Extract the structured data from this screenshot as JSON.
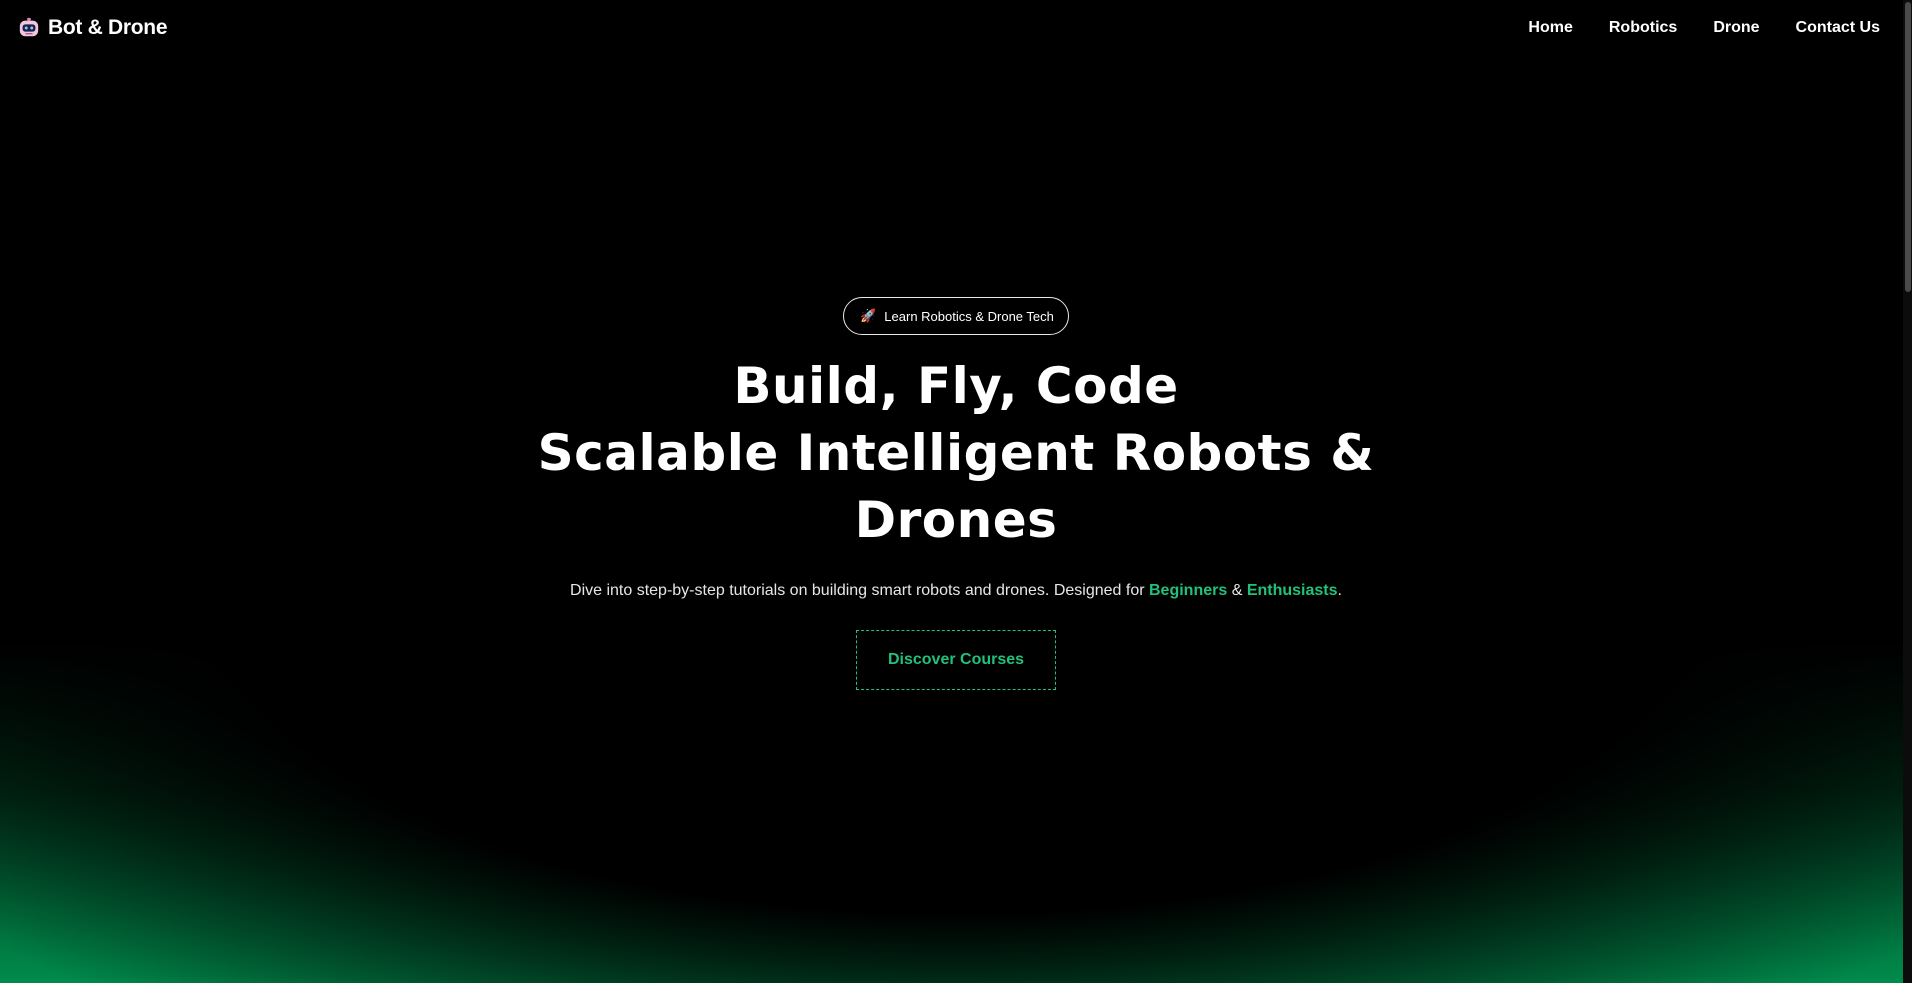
{
  "brand": {
    "name": "Bot & Drone",
    "icon": "robot-icon"
  },
  "nav": {
    "items": [
      "Home",
      "Robotics",
      "Drone",
      "Contact Us"
    ]
  },
  "hero": {
    "badge_icon": "🚀",
    "badge_label": "Learn Robotics & Drone Tech",
    "title_line1": "Build, Fly, Code",
    "title_line2": "Scalable Intelligent Robots &",
    "title_line3": "Drones",
    "subtitle_prefix": "Dive into step-by-step tutorials on building smart robots and drones. Designed for",
    "highlight_1": "Beginners",
    "joiner": "&",
    "highlight_2": "Enthusiasts",
    "subtitle_suffix": ".",
    "cta_label": "Discover Courses"
  },
  "colors": {
    "background": "#000000",
    "accent": "#22c07a",
    "glow": "#008a4b"
  }
}
